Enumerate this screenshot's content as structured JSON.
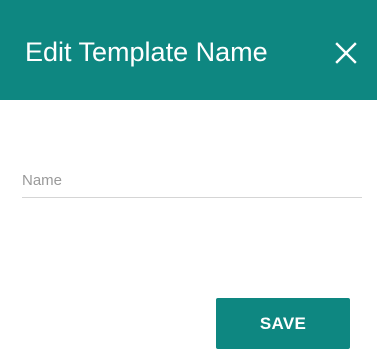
{
  "dialog": {
    "title": "Edit Template Name",
    "close_icon": "close-icon",
    "name_field": {
      "placeholder": "Name",
      "value": ""
    },
    "save_label": "SAVE"
  },
  "colors": {
    "accent": "#0e8781",
    "header_text": "#ffffff",
    "placeholder": "#9a9a9a",
    "underline": "#d5d5d5"
  }
}
